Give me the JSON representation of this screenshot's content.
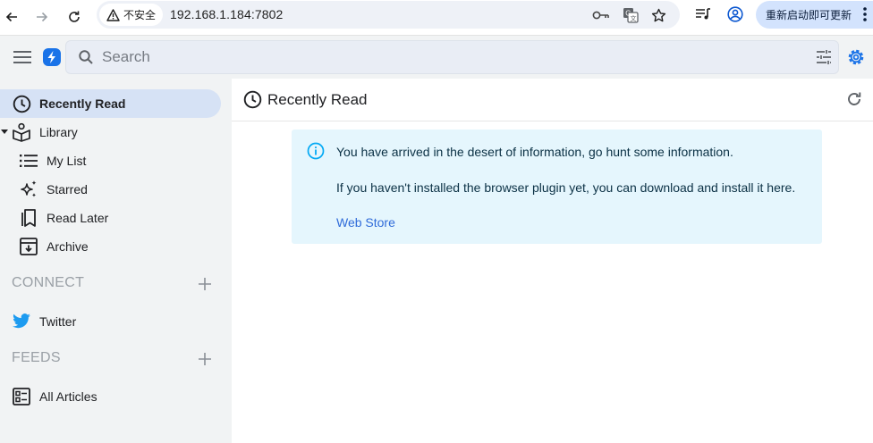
{
  "browser": {
    "security_label": "不安全",
    "url": "192.168.1.184:7802",
    "update_label": "重新启动即可更新"
  },
  "toolbar": {
    "search_placeholder": "Search"
  },
  "sidebar": {
    "items": [
      {
        "label": "Recently Read",
        "icon": "clock-icon",
        "active": true
      },
      {
        "label": "Library",
        "icon": "library-icon"
      },
      {
        "label": "My List",
        "icon": "list-icon"
      },
      {
        "label": "Starred",
        "icon": "sparkle-icon"
      },
      {
        "label": "Read Later",
        "icon": "bookmark-icon"
      },
      {
        "label": "Archive",
        "icon": "archive-icon"
      }
    ],
    "connect": {
      "heading": "CONNECT",
      "items": [
        {
          "label": "Twitter",
          "icon": "twitter-icon"
        }
      ]
    },
    "feeds": {
      "heading": "FEEDS",
      "items": [
        {
          "label": "All Articles",
          "icon": "articles-icon"
        }
      ]
    }
  },
  "main": {
    "title": "Recently Read",
    "info": {
      "line1": "You have arrived in the desert of information, go hunt some information.",
      "line2": "If you haven't installed the browser plugin yet, you can download and install it here.",
      "link": "Web Store"
    }
  },
  "colors": {
    "accent": "#1a73e8",
    "sidebar_bg": "#f1f3f4",
    "active_bg": "#d6e2f5",
    "info_bg": "#e5f6fd",
    "link": "#2f6bd9"
  }
}
